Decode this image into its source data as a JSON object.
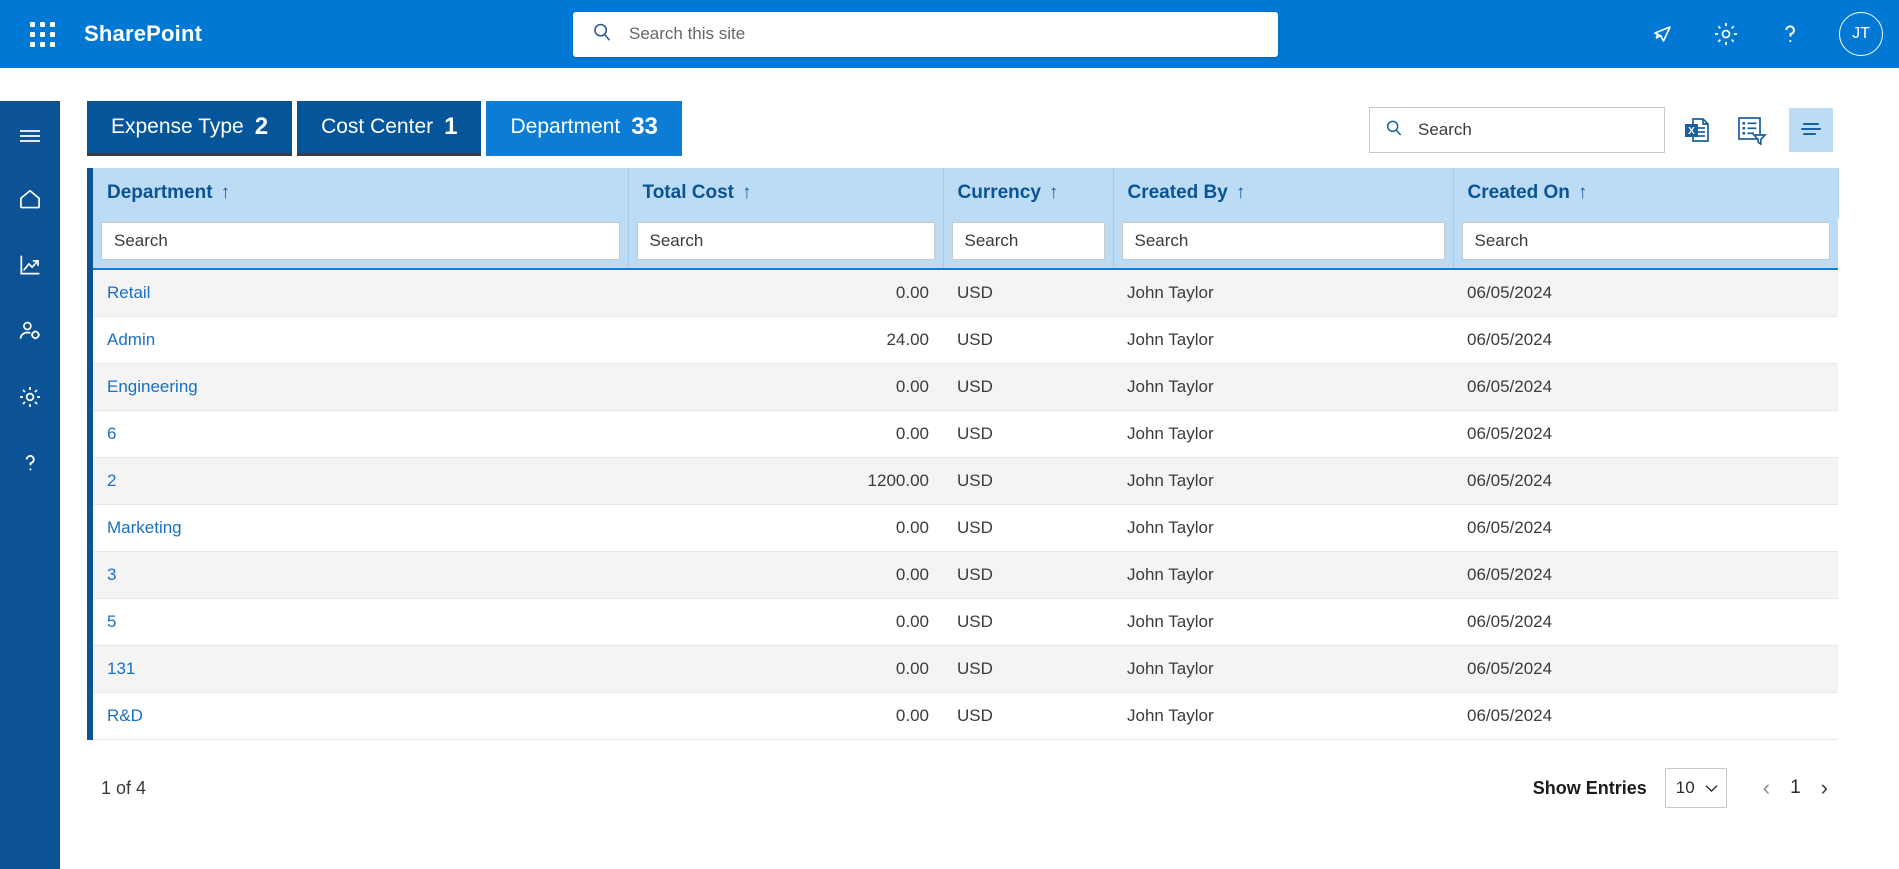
{
  "suite": {
    "brand": "SharePoint",
    "search_placeholder": "Search this site",
    "avatar_initials": "JT",
    "accent": "#0078d4"
  },
  "rail": {
    "items": [
      {
        "icon": "hamburger-icon",
        "name": "menu-toggle"
      },
      {
        "icon": "home-icon",
        "name": "home"
      },
      {
        "icon": "analytics-icon",
        "name": "analytics"
      },
      {
        "icon": "user-settings-icon",
        "name": "user-settings"
      },
      {
        "icon": "gear-icon",
        "name": "settings"
      },
      {
        "icon": "help-icon",
        "name": "help"
      }
    ]
  },
  "tabs": [
    {
      "label": "Expense Type",
      "count": "2",
      "active": false
    },
    {
      "label": "Cost Center",
      "count": "1",
      "active": false
    },
    {
      "label": "Department",
      "count": "33",
      "active": true
    }
  ],
  "toolbar": {
    "search_placeholder": "Search",
    "excel_export": "excel-export-icon",
    "list_export": "filtered-list-export-icon",
    "view_toggle": "sort-lines-icon"
  },
  "table": {
    "sort_arrow": "↑",
    "filter_placeholder": "Search",
    "columns": [
      {
        "label": "Department",
        "key": "department"
      },
      {
        "label": "Total Cost",
        "key": "total_cost"
      },
      {
        "label": "Currency",
        "key": "currency"
      },
      {
        "label": "Created By",
        "key": "created_by"
      },
      {
        "label": "Created On",
        "key": "created_on"
      }
    ],
    "rows": [
      {
        "department": "Retail",
        "total_cost": "0.00",
        "currency": "USD",
        "created_by": "John Taylor",
        "created_on": "06/05/2024"
      },
      {
        "department": "Admin",
        "total_cost": "24.00",
        "currency": "USD",
        "created_by": "John Taylor",
        "created_on": "06/05/2024"
      },
      {
        "department": "Engineering",
        "total_cost": "0.00",
        "currency": "USD",
        "created_by": "John Taylor",
        "created_on": "06/05/2024"
      },
      {
        "department": "6",
        "total_cost": "0.00",
        "currency": "USD",
        "created_by": "John Taylor",
        "created_on": "06/05/2024"
      },
      {
        "department": "2",
        "total_cost": "1200.00",
        "currency": "USD",
        "created_by": "John Taylor",
        "created_on": "06/05/2024"
      },
      {
        "department": "Marketing",
        "total_cost": "0.00",
        "currency": "USD",
        "created_by": "John Taylor",
        "created_on": "06/05/2024"
      },
      {
        "department": "3",
        "total_cost": "0.00",
        "currency": "USD",
        "created_by": "John Taylor",
        "created_on": "06/05/2024"
      },
      {
        "department": "5",
        "total_cost": "0.00",
        "currency": "USD",
        "created_by": "John Taylor",
        "created_on": "06/05/2024"
      },
      {
        "department": "131",
        "total_cost": "0.00",
        "currency": "USD",
        "created_by": "John Taylor",
        "created_on": "06/05/2024"
      },
      {
        "department": "R&D",
        "total_cost": "0.00",
        "currency": "USD",
        "created_by": "John Taylor",
        "created_on": "06/05/2024"
      }
    ]
  },
  "footer": {
    "page_info": "1 of 4",
    "show_entries_label": "Show Entries",
    "entries_value": "10",
    "prev_arrow": "‹",
    "current_page": "1",
    "next_arrow": "›"
  }
}
